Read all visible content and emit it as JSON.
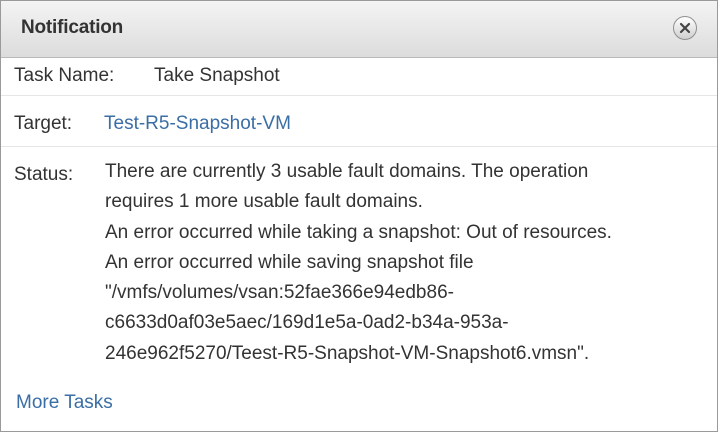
{
  "dialog": {
    "title": "Notification",
    "close_icon": "close-icon"
  },
  "task": {
    "name_label": "Task Name:",
    "name_value": "Take Snapshot",
    "target_label": "Target:",
    "target_value": "Test-R5-Snapshot-VM",
    "status_label": "Status:",
    "status_lines": [
      "There are currently 3 usable fault domains. The operation",
      "requires 1 more usable fault domains.",
      "An error occurred while taking a snapshot: Out of resources.",
      "An error occurred while saving snapshot file",
      "\"/vmfs/volumes/vsan:52fae366e94edb86-",
      "c6633d0af03e5aec/169d1e5a-0ad2-b34a-953a-",
      "246e962f5270/Teest-R5-Snapshot-VM-Snapshot6.vmsn\"."
    ]
  },
  "footer": {
    "more_tasks_label": "More Tasks"
  },
  "colors": {
    "link": "#3a6ea5",
    "text": "#333333"
  }
}
